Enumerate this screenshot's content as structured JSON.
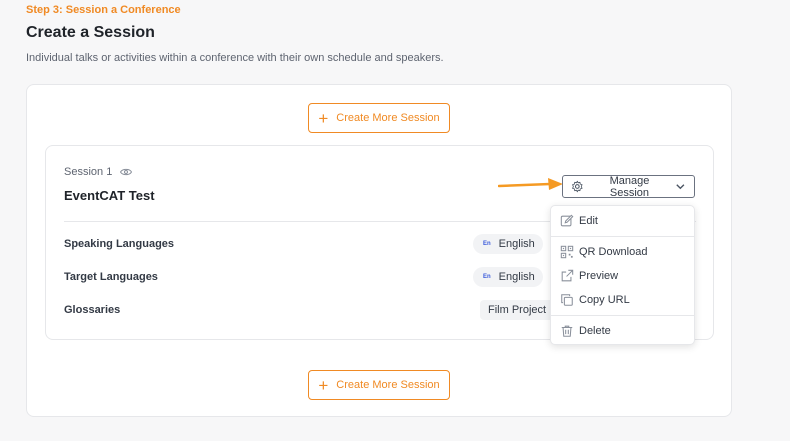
{
  "header": {
    "step": "Step 3: Session a Conference",
    "title": "Create a Session",
    "subtitle": "Individual talks or activities within a conference with their own schedule and speakers."
  },
  "create_button_label": "Create More Session",
  "session": {
    "label": "Session 1",
    "name": "EventCAT Test",
    "rows": [
      {
        "label": "Speaking Languages",
        "code": "En",
        "value": "English"
      },
      {
        "label": "Target Languages",
        "code": "En",
        "value": "English"
      },
      {
        "label": "Glossaries",
        "value": "Film Project F"
      }
    ]
  },
  "manage": {
    "label": "Manage Session",
    "menu": [
      {
        "label": "Edit",
        "icon": "edit-icon"
      },
      {
        "label": "QR Download",
        "icon": "qr-icon"
      },
      {
        "label": "Preview",
        "icon": "external-link-icon"
      },
      {
        "label": "Copy URL",
        "icon": "copy-icon"
      },
      {
        "label": "Delete",
        "icon": "trash-icon"
      }
    ]
  },
  "colors": {
    "accent": "#f08a24",
    "text": "#1f2329",
    "muted": "#5e6470",
    "border": "#e6e7ea"
  }
}
